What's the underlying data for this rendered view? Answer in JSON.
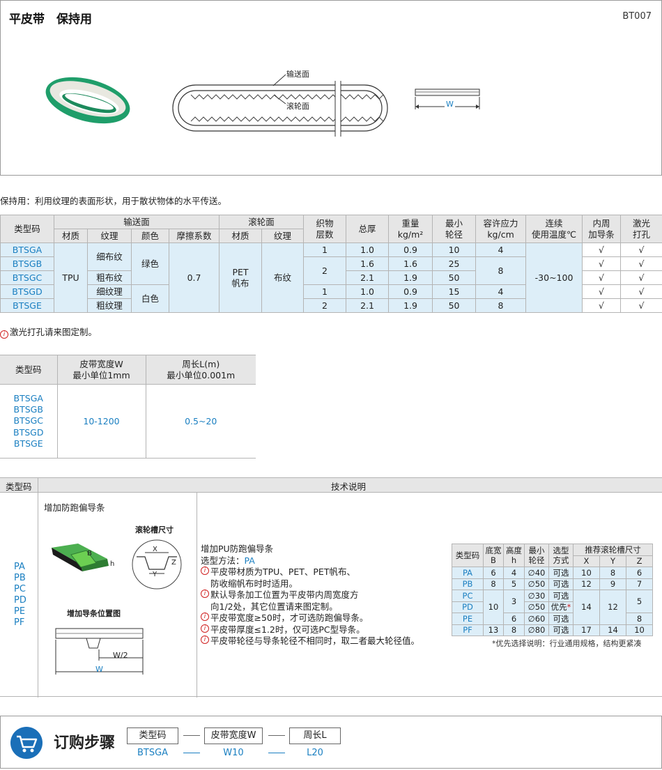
{
  "header": {
    "title": "平皮带　保持用",
    "code": "BT007"
  },
  "diagram": {
    "label_top": "输送面",
    "label_bottom": "滚轮面",
    "width_label": "W"
  },
  "description": "保持用：利用纹理的表面形状，用于散状物体的水平传送。",
  "spec_table": {
    "headers": {
      "type_code": "类型码",
      "conveying_face": "输送面",
      "roller_face": "滚轮面",
      "material": "材质",
      "texture": "纹理",
      "color": "颜色",
      "friction": "摩擦系数",
      "material2": "材质",
      "texture2": "纹理",
      "fabric_layers": "织物\n层数",
      "thickness": "总厚",
      "weight": "重量\nkg/m²",
      "min_pulley": "最小\n轮径",
      "tension": "容许应力\nkg/cm",
      "temp": "连续\n使用温度℃",
      "guide": "内周\n加导条",
      "laser": "激光\n打孔"
    },
    "rows": [
      {
        "code": "BTSGA",
        "layers": "1",
        "thickness": "1.0",
        "weight": "0.9",
        "pulley": "10",
        "guide": "√",
        "laser": "√"
      },
      {
        "code": "BTSGB",
        "thickness": "1.6",
        "weight": "1.6",
        "pulley": "25",
        "guide": "√",
        "laser": "√"
      },
      {
        "code": "BTSGC",
        "thickness": "2.1",
        "weight": "1.9",
        "pulley": "50",
        "guide": "√",
        "laser": "√"
      },
      {
        "code": "BTSGD",
        "layers": "1",
        "thickness": "1.0",
        "weight": "0.9",
        "pulley": "15",
        "guide": "√",
        "laser": "√"
      },
      {
        "code": "BTSGE",
        "layers": "2",
        "thickness": "2.1",
        "weight": "1.9",
        "pulley": "50",
        "guide": "√",
        "laser": "√"
      }
    ],
    "merged": {
      "material": "TPU",
      "tex_fine": "细布纹",
      "tex_coarse": "粗布纹",
      "tex_fine2": "细纹理",
      "tex_coarse2": "粗纹理",
      "green": "绿色",
      "white": "白色",
      "friction": "0.7",
      "roller_material": "PET\n帆布",
      "roller_texture": "布纹",
      "layers_bc": "2",
      "tension_a": "4",
      "tension_bc": "8",
      "tension_d": "4",
      "tension_e": "8",
      "temp": "-30~100"
    }
  },
  "note1": "激光打孔请来图定制。",
  "size_table": {
    "h_code": "类型码",
    "h_width": "皮带宽度W\n最小单位1mm",
    "h_length": "周长L(m)\n最小单位0.001m",
    "codes": "BTSGA\nBTSGB\nBTSGC\nBTSGD\nBTSGE",
    "width": "10-1200",
    "length": "0.5~20"
  },
  "tech": {
    "h_code": "类型码",
    "h_desc": "技术说明",
    "codes": "PA\nPB\nPC\nPD\nPE\nPF",
    "add_guide": "增加防跑偏导条",
    "groove_size": "滚轮槽尺寸",
    "guide_position": "增加导条位置图",
    "fig_b": "B",
    "fig_h": "h",
    "fig_x": "X",
    "fig_y": "Y",
    "fig_z": "Z",
    "fig_w2": "W/2",
    "fig_w": "W",
    "pu_title": "增加PU防跑偏导条",
    "select_method": "选型方法：",
    "select_value": "PA",
    "notes": [
      "平皮带材质为TPU、PET、PET帆布、\n防收缩帆布时时适用。",
      "默认导条加工位置为平皮带内周宽度方\n向1/2处，其它位置请来图定制。",
      "平皮带宽度≥50时，才可选防跑偏导条。",
      "平皮带厚度≤1.2时，仅可选PC型导条。",
      "平皮带轮径与导条轮径不相同时，取二者最大轮径值。"
    ],
    "guide_table": {
      "headers": {
        "code": "类型码",
        "base": "底宽\nB",
        "height": "高度\nh",
        "min_d": "最小\n轮径",
        "option": "选型\n方式",
        "groove": "推荐滚轮槽尺寸",
        "x": "X",
        "y": "Y",
        "z": "Z"
      },
      "rows": [
        {
          "code": "PA",
          "b": "6",
          "h": "4",
          "d": "∅40",
          "opt": "可选",
          "x": "10",
          "y": "8",
          "z": "6"
        },
        {
          "code": "PB",
          "b": "8",
          "h": "5",
          "d": "∅50",
          "opt": "可选",
          "x": "12",
          "y": "9",
          "z": "7"
        },
        {
          "code": "PC",
          "d": "∅30",
          "opt": "可选"
        },
        {
          "code": "PD",
          "d": "∅50",
          "opt": "优先"
        },
        {
          "code": "PE",
          "h": "6",
          "d": "∅60",
          "opt": "可选",
          "z": "8"
        },
        {
          "code": "PF",
          "b": "13",
          "h": "8",
          "d": "∅80",
          "opt": "可选",
          "x": "17",
          "y": "14",
          "z": "10"
        }
      ],
      "merged": {
        "b_cde": "10",
        "h_cd": "3",
        "x_cde": "14",
        "y_cde": "12",
        "z_cd": "5"
      },
      "star": "*",
      "footnote": "*优先选择说明：行业通用规格，结构更紧凑"
    }
  },
  "order": {
    "title": "订购步骤",
    "steps": [
      {
        "label": "类型码",
        "value": "BTSGA"
      },
      {
        "label": "皮带宽度W",
        "value": "W10"
      },
      {
        "label": "周长L",
        "value": "L20"
      }
    ]
  },
  "colors": {
    "accent_blue": "#1a7fc1",
    "belt_green": "#1f9e6a",
    "header_gray": "#e6e6e6",
    "cell_blue": "#ddeef8"
  }
}
